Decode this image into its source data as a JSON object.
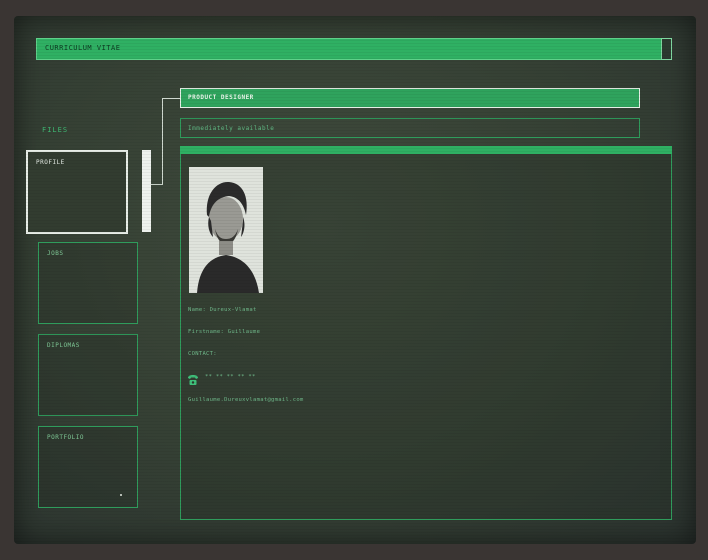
{
  "window": {
    "title": "CURRICULUM VITAE"
  },
  "sidebar": {
    "label": "FILES",
    "items": [
      {
        "label": "PROFILE",
        "active": true
      },
      {
        "label": "JOBS",
        "active": false
      },
      {
        "label": "DIPLOMAS",
        "active": false
      },
      {
        "label": "PORTFOLIO",
        "active": false
      }
    ]
  },
  "profile": {
    "job_title": "PRODUCT DESIGNER",
    "availability": "Immediately available",
    "name_line": "Name: Dureux-Vlamat",
    "firstname_line": "Firstname: Guillaume",
    "contact_label": "CONTACT:",
    "phone": "** ** ** ** **",
    "email": "Guillaume.Dureuxvlamat@gmail.com"
  },
  "colors": {
    "accent": "#2fb063",
    "border": "#2f9c5c",
    "screen_bg": "#354034",
    "bezel": "#3a3533"
  },
  "icons": {
    "phone": "telephone-icon"
  }
}
